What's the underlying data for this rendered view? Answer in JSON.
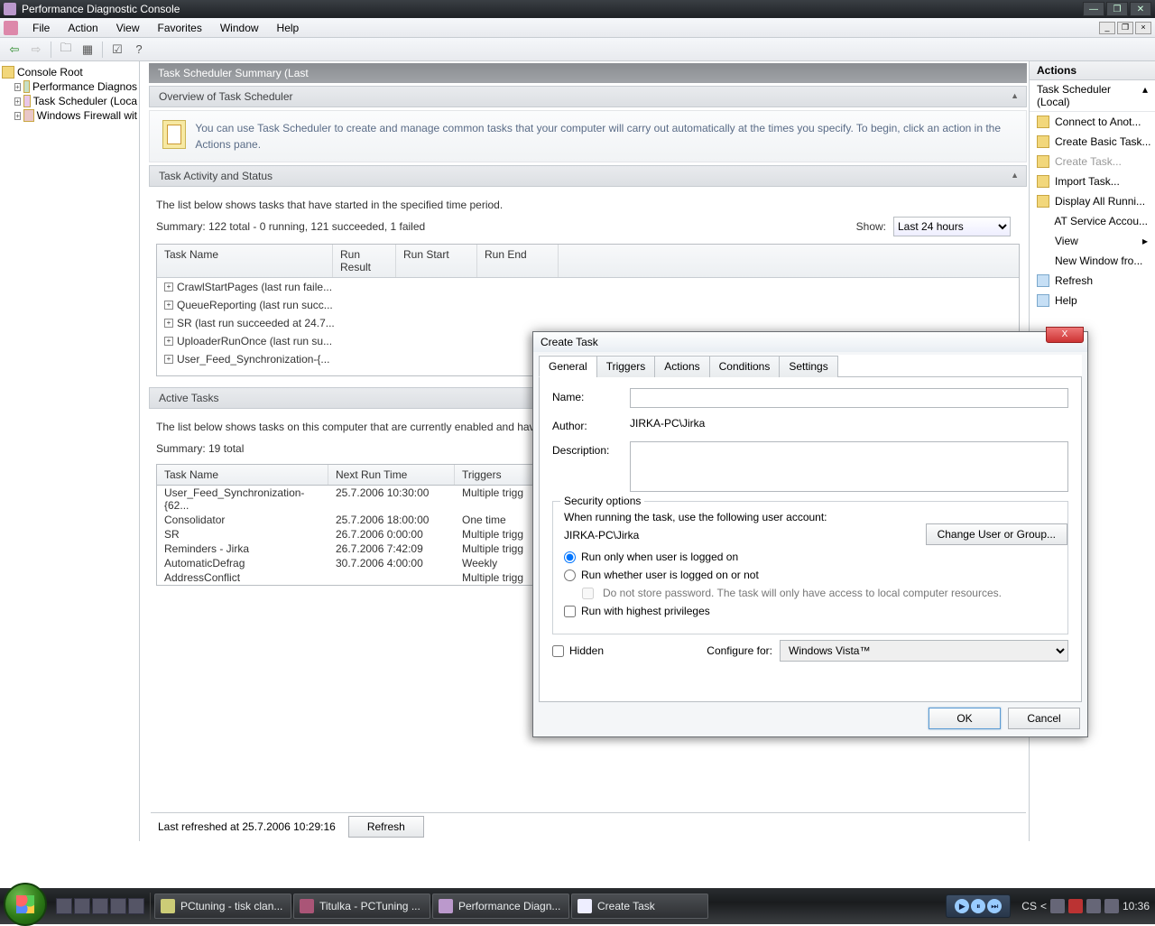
{
  "titlebar": {
    "title": "Performance Diagnostic Console"
  },
  "menubar": {
    "items": [
      "File",
      "Action",
      "View",
      "Favorites",
      "Window",
      "Help"
    ]
  },
  "tree": {
    "root": "Console Root",
    "items": [
      "Performance Diagnos",
      "Task Scheduler  (Loca",
      "Windows Firewall wit"
    ]
  },
  "summary_header": "Task Scheduler Summary (Last",
  "overview": {
    "title": "Overview of Task Scheduler",
    "text": "You can use Task Scheduler to create and manage common tasks that your computer will carry out automatically at the times you specify. To begin, click an action in the Actions pane."
  },
  "activity": {
    "title": "Task Activity and Status",
    "line1": "The list below shows tasks that have started in the specified time period.",
    "line2": "Summary: 122 total - 0 running, 121 succeeded, 1 failed",
    "show_label": "Show:",
    "show_value": "Last 24 hours",
    "cols": [
      "Task Name",
      "Run Result",
      "Run Start",
      "Run End"
    ],
    "rows": [
      "CrawlStartPages (last run faile...",
      "QueueReporting (last run succ...",
      "SR (last run succeeded at 24.7...",
      "UploaderRunOnce (last run su...",
      "User_Feed_Synchronization-{..."
    ]
  },
  "active": {
    "title": "Active Tasks",
    "line1": "The list below shows tasks on this computer that are currently enabled and hav",
    "line2": "Summary: 19 total",
    "cols": [
      "Task Name",
      "Next Run Time",
      "Triggers"
    ],
    "rows": [
      {
        "n": "User_Feed_Synchronization-{62...",
        "t": "25.7.2006 10:30:00",
        "g": "Multiple trigg"
      },
      {
        "n": "Consolidator",
        "t": "25.7.2006 18:00:00",
        "g": "One time"
      },
      {
        "n": "SR",
        "t": "26.7.2006 0:00:00",
        "g": "Multiple trigg"
      },
      {
        "n": "Reminders - Jirka",
        "t": "26.7.2006 7:42:09",
        "g": "Multiple trigg"
      },
      {
        "n": "AutomaticDefrag",
        "t": "30.7.2006 4:00:00",
        "g": "Weekly"
      },
      {
        "n": "AddressConflict",
        "t": "",
        "g": "Multiple trigg"
      }
    ]
  },
  "refresh": {
    "text": "Last refreshed at 25.7.2006 10:29:16",
    "btn": "Refresh"
  },
  "actions": {
    "header": "Actions",
    "group": "Task Scheduler  (Local)",
    "items": [
      {
        "l": "Connect to Anot...",
        "d": false
      },
      {
        "l": "Create Basic Task...",
        "d": false
      },
      {
        "l": "Create Task...",
        "d": true
      },
      {
        "l": "Import Task...",
        "d": false
      },
      {
        "l": "Display All Runni...",
        "d": false
      },
      {
        "l": "AT Service Accou...",
        "d": false,
        "noicon": true
      },
      {
        "l": "View",
        "d": false,
        "noicon": true,
        "arrow": true
      },
      {
        "l": "New Window fro...",
        "d": false,
        "noicon": true
      },
      {
        "l": "Refresh",
        "d": false,
        "blue": true
      },
      {
        "l": "Help",
        "d": false,
        "blue": true
      }
    ]
  },
  "dialog": {
    "title": "Create Task",
    "tabs": [
      "General",
      "Triggers",
      "Actions",
      "Conditions",
      "Settings"
    ],
    "name_label": "Name:",
    "author_label": "Author:",
    "author_value": "JIRKA-PC\\Jirka",
    "desc_label": "Description:",
    "sec_legend": "Security options",
    "sec_line": "When running the task, use the following user account:",
    "sec_user": "JIRKA-PC\\Jirka",
    "chg_btn": "Change User or Group...",
    "opt1": "Run only when user is logged on",
    "opt2": "Run whether user is logged on or not",
    "opt2_note": "Do not store password.  The task will only have access to local computer resources.",
    "opt3": "Run with highest privileges",
    "hidden": "Hidden",
    "configure_label": "Configure for:",
    "configure_value": "Windows Vista™",
    "ok": "OK",
    "cancel": "Cancel"
  },
  "taskbar": {
    "items": [
      "PCtuning - tisk clan...",
      "Titulka - PCTuning ...",
      "Performance Diagn...",
      "Create Task"
    ],
    "lang": "CS",
    "time": "10:36"
  }
}
